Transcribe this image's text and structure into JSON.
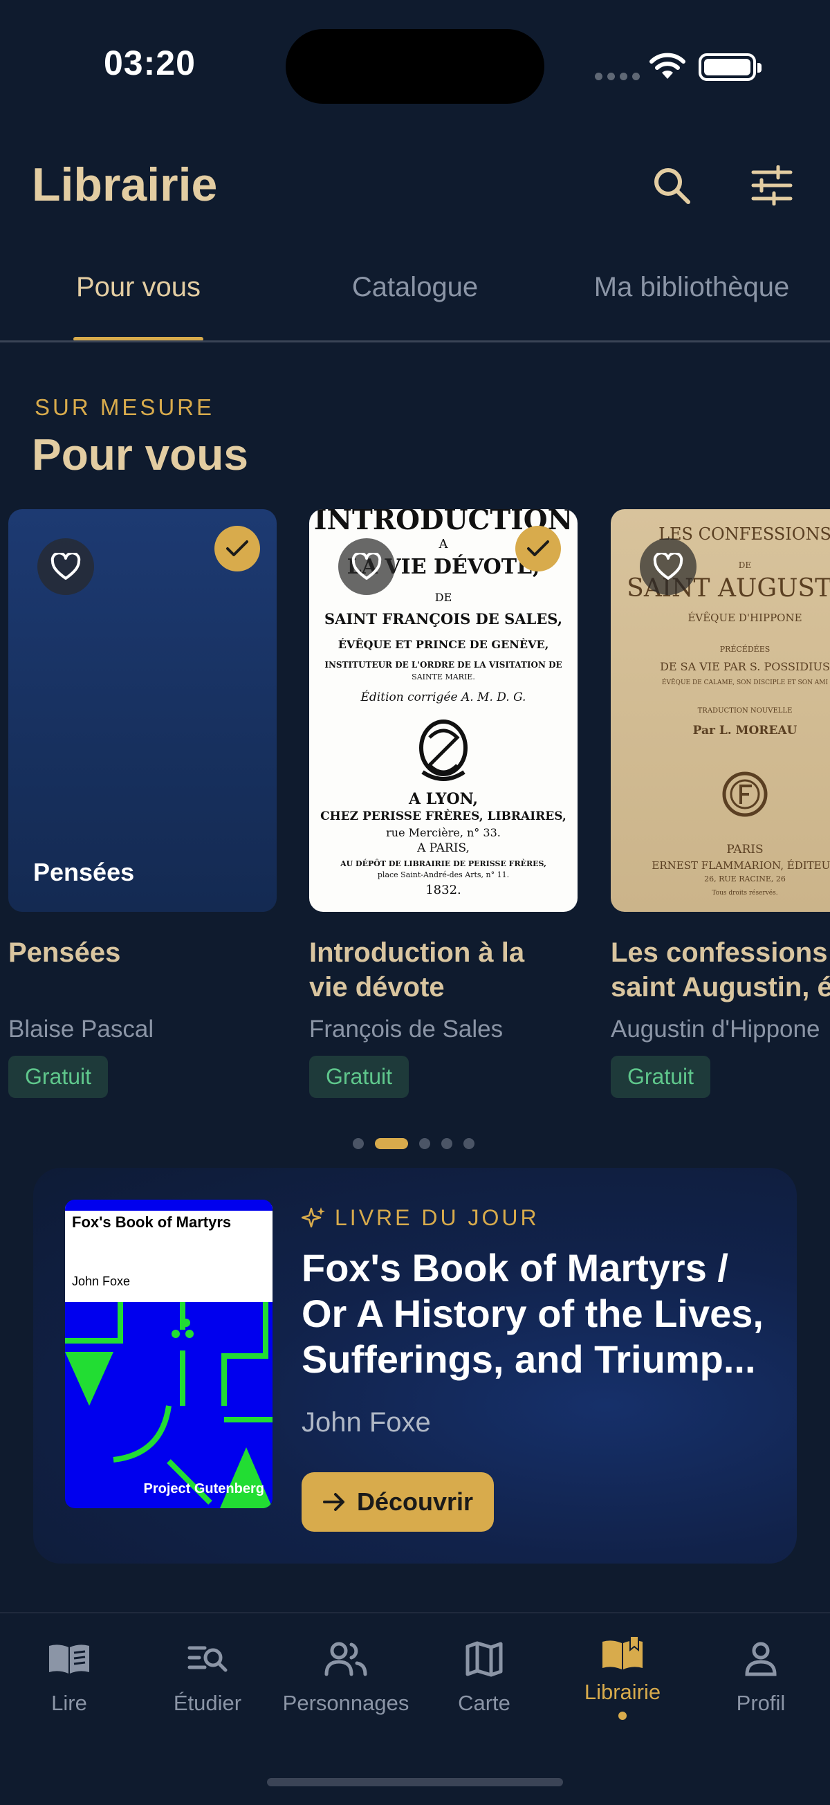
{
  "status_bar": {
    "time": "03:20"
  },
  "header": {
    "title": "Librairie"
  },
  "tabs": [
    {
      "label": "Pour vous",
      "active": true
    },
    {
      "label": "Catalogue",
      "active": false
    },
    {
      "label": "Ma bibliothèque",
      "active": false
    }
  ],
  "section": {
    "eyebrow": "SUR MESURE",
    "title": "Pour vous"
  },
  "books": [
    {
      "title": "Pensées",
      "title_line2": "",
      "author": "Blaise Pascal",
      "badge": "Gratuit",
      "cover_label": "Pensées"
    },
    {
      "title": "Introduction à la",
      "title_line2": "vie dévote",
      "author": "François de Sales",
      "badge": "Gratuit",
      "cover_lines": [
        "INTRODUCTION",
        "A",
        "LA VIE DÉVOTE,",
        "DE",
        "SAINT FRANÇOIS DE SALES,",
        "ÉVÊQUE ET PRINCE DE GENÈVE,",
        "INSTITUTEUR DE L'ORDRE DE LA VISITATION DE",
        "SAINTE MARIE.",
        "Édition corrigée A. M. D. G.",
        "A LYON,",
        "CHEZ PERISSE FRÈRES, LIBRAIRES,",
        "rue Mercière, n° 33.",
        "A PARIS,",
        "AU DÉPÔT DE LIBRAIRIE DE PERISSE FRÈRES,",
        "place Saint-André-des Arts, n° 11.",
        "1832."
      ]
    },
    {
      "title": "Les confessions de",
      "title_line2": "saint Augustin, é",
      "author": "Augustin d'Hippone",
      "badge": "Gratuit",
      "cover_lines": [
        "LES CONFESSIONS",
        "DE",
        "SAINT AUGUSTIN",
        "ÉVÊQUE D'HIPPONE",
        "PRÉCÉDÉES",
        "DE SA VIE PAR S. POSSIDIUS",
        "ÉVÊQUE DE CALAME, SON DISCIPLE ET SON AMI",
        "TRADUCTION NOUVELLE",
        "Par L. MOREAU",
        "PARIS",
        "ERNEST FLAMMARION, ÉDITEUR",
        "26, RUE RACINE, 26",
        "Tous droits réservés."
      ]
    }
  ],
  "carousel": {
    "pages": 5,
    "current": 2
  },
  "book_of_day": {
    "eyebrow": "LIVRE DU JOUR",
    "title": "Fox's Book of Martyrs / Or A History of the Lives, Sufferings, and Triump...",
    "author": "John Foxe",
    "button_label": "Découvrir",
    "cover_title": "Fox's Book of Martyrs",
    "cover_author": "John Foxe",
    "cover_publisher": "Project Gutenberg"
  },
  "bottom_nav": [
    {
      "label": "Lire",
      "icon": "book-open-icon",
      "active": false
    },
    {
      "label": "Étudier",
      "icon": "study-search-icon",
      "active": false
    },
    {
      "label": "Personnages",
      "icon": "people-icon",
      "active": false
    },
    {
      "label": "Carte",
      "icon": "map-icon",
      "active": false
    },
    {
      "label": "Librairie",
      "icon": "library-icon",
      "active": true
    },
    {
      "label": "Profil",
      "icon": "user-icon",
      "active": false
    }
  ],
  "colors": {
    "background": "#0f1b2e",
    "accent": "#d8ab4c",
    "title": "#e3cda2",
    "muted": "#8b95a6",
    "badge_text": "#5fc78c"
  }
}
